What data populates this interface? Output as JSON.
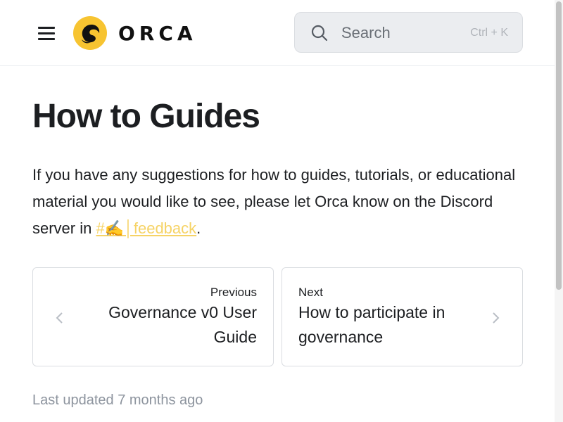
{
  "navbar": {
    "logo_text": "ORCA",
    "logo_icon": "orca-logo-icon",
    "menu_icon": "hamburger-menu-icon",
    "search": {
      "placeholder": "Search",
      "shortcut": "Ctrl + K",
      "icon": "search-icon"
    }
  },
  "page": {
    "title": "How to Guides",
    "intro_text": "If you have any suggestions for how to guides, tutorials, or educational material you would like to see, please let Orca know on the Discord server in ",
    "link_text": "#✍️│feedback",
    "intro_end": "."
  },
  "pagination": {
    "prev": {
      "sublabel": "Previous",
      "label": "Governance v0 User Guide",
      "icon": "chevron-left-icon"
    },
    "next": {
      "sublabel": "Next",
      "label": "How to participate in governance",
      "icon": "chevron-right-icon"
    }
  },
  "footer": {
    "last_updated": "Last updated 7 months ago"
  },
  "colors": {
    "accent": "#f6d365",
    "logo_yellow": "#f7c431",
    "text": "#1c1e21",
    "muted": "#8d949e"
  }
}
